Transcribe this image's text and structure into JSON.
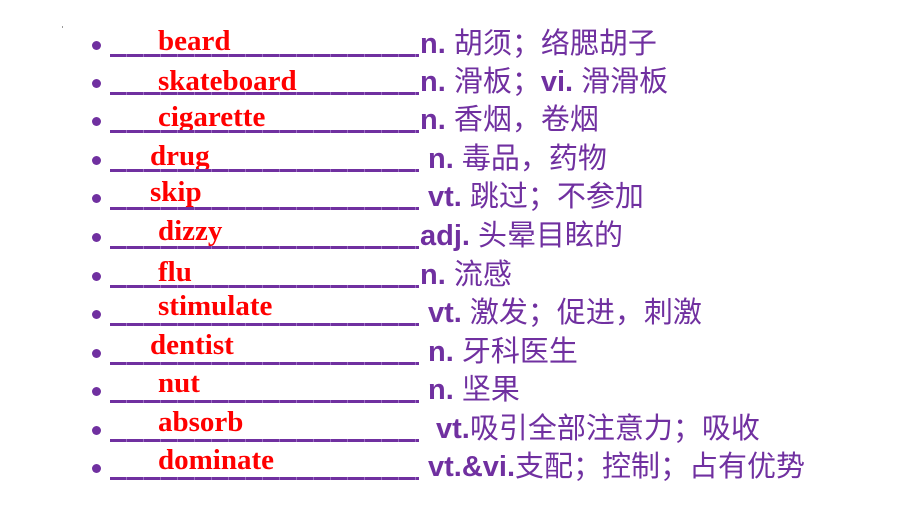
{
  "slide": {
    "items": [
      {
        "answer": "beard",
        "pos": "n. ",
        "meaning": "胡须；络腮胡子"
      },
      {
        "answer": "skateboard",
        "pos": "n. ",
        "meaning": "滑板；",
        "pos2": "vi. ",
        "meaning2": "滑滑板"
      },
      {
        "answer": "cigarette",
        "pos": "n. ",
        "meaning": "香烟，卷烟"
      },
      {
        "answer": "drug",
        "pos": "n. ",
        "meaning": "毒品，药物"
      },
      {
        "answer": "skip",
        "pos": "vt. ",
        "meaning": "跳过；不参加"
      },
      {
        "answer": "dizzy",
        "pos": "adj. ",
        "meaning": "头晕目眩的"
      },
      {
        "answer": "flu",
        "pos": "n. ",
        "meaning": "流感"
      },
      {
        "answer": "stimulate",
        "pos": "vt. ",
        "meaning": "激发；促进，刺激"
      },
      {
        "answer": "dentist",
        "pos": "n. ",
        "meaning": "牙科医生"
      },
      {
        "answer": "nut",
        "pos": "n. ",
        "meaning": "坚果"
      },
      {
        "answer": "absorb",
        "pos": "vt.",
        "meaning": "吸引全部注意力；吸收"
      },
      {
        "answer": "dominate",
        "pos": "vt.&vi.",
        "meaning": "支配；控制；占有优势"
      }
    ]
  },
  "colors": {
    "answer": "#ff0000",
    "text": "#7030a0",
    "background": "#ffffff"
  }
}
